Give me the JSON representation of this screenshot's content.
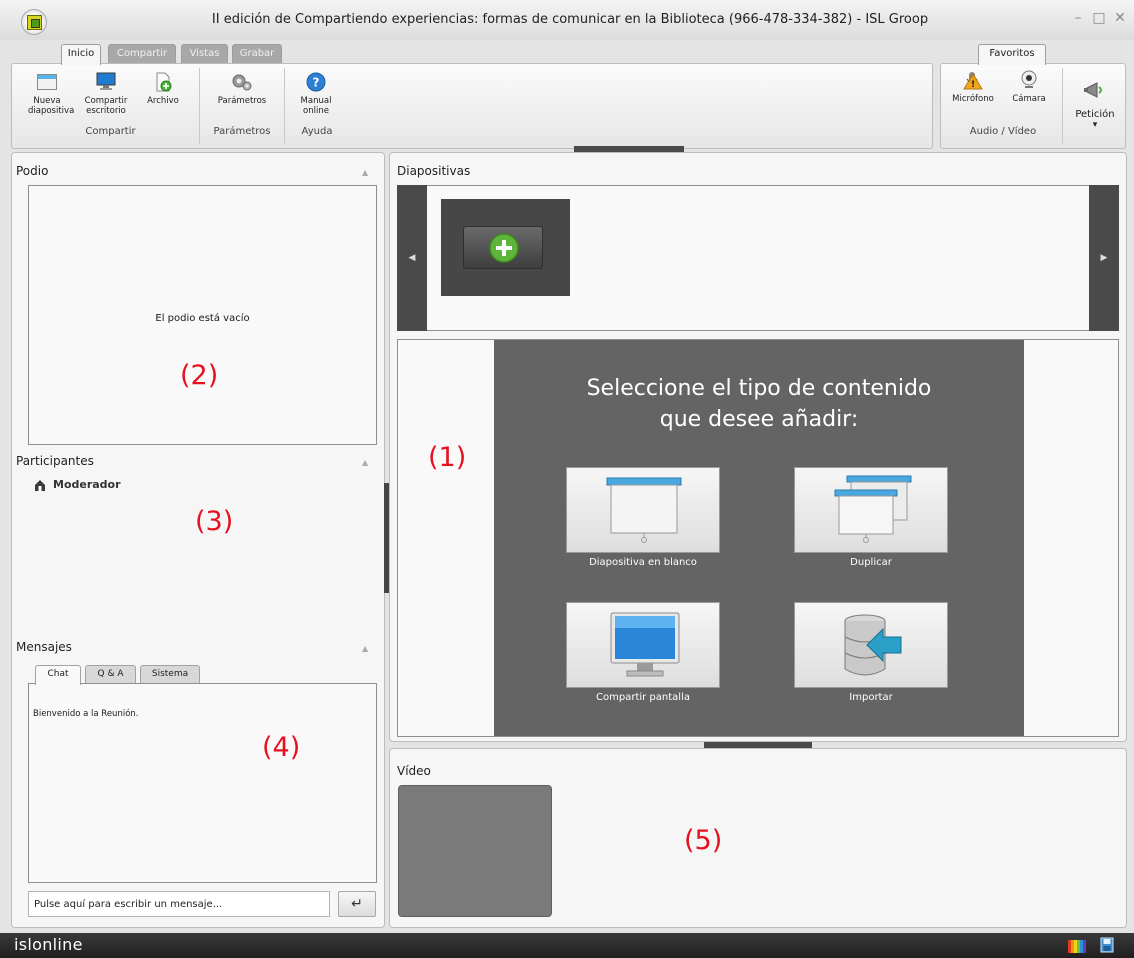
{
  "window": {
    "title": "II edición de Compartiendo experiencias: formas de comunicar en la Biblioteca (966-478-334-382) - ISL Groop",
    "controls": {
      "minimize": "–",
      "maximize": "□",
      "close": "✕"
    }
  },
  "ribbon": {
    "tabs": [
      "Inicio",
      "Compartir",
      "Vistas",
      "Grabar"
    ],
    "active_tab": "Inicio",
    "favorites_tab": "Favoritos",
    "groups": {
      "compartir": {
        "label": "Compartir",
        "buttons": [
          {
            "line1": "Nueva",
            "line2": "diapositiva",
            "icon": "slide-icon"
          },
          {
            "line1": "Compartir",
            "line2": "escritorio",
            "icon": "monitor-icon"
          },
          {
            "line1": "Archivo",
            "line2": "",
            "icon": "file-add-icon"
          }
        ]
      },
      "parametros": {
        "label": "Parámetros",
        "buttons": [
          {
            "line1": "Parámetros",
            "line2": "",
            "icon": "gears-icon"
          }
        ]
      },
      "ayuda": {
        "label": "Ayuda",
        "buttons": [
          {
            "line1": "Manual",
            "line2": "online",
            "icon": "help-icon"
          }
        ]
      },
      "audio_video": {
        "label": "Audio / Vídeo",
        "buttons": [
          {
            "line1": "Micrófono",
            "icon": "microphone-warning-icon"
          },
          {
            "line1": "Cámara",
            "icon": "webcam-icon"
          }
        ]
      },
      "peticion": {
        "label": "Petición",
        "icon": "megaphone-icon",
        "arrow": "▾"
      }
    }
  },
  "left": {
    "podio": {
      "title": "Podio",
      "empty_text": "El podio está vacío",
      "marker": "(2)",
      "collapse": "▲"
    },
    "participantes": {
      "title": "Participantes",
      "moderator": "Moderador",
      "marker": "(3)",
      "collapse": "▲"
    },
    "mensajes": {
      "title": "Mensajes",
      "collapse": "▲",
      "tabs": [
        "Chat",
        "Q & A",
        "Sistema"
      ],
      "active_tab": "Chat",
      "messages": [
        "Bienvenido a la Reunión."
      ],
      "marker": "(4)",
      "input_placeholder": "Pulse aquí para escribir un mensaje...",
      "send_icon": "↵"
    }
  },
  "right": {
    "diapositivas": {
      "title": "Diapositivas",
      "prev": "◀",
      "next": "▶"
    },
    "content": {
      "marker": "(1)",
      "heading_line1": "Seleccione el tipo de contenido",
      "heading_line2": "que desee añadir:",
      "options": [
        {
          "label": "Diapositiva en blanco",
          "icon": "blank-slide-icon"
        },
        {
          "label": "Duplicar",
          "icon": "duplicate-slides-icon"
        },
        {
          "label": "Compartir pantalla",
          "icon": "screen-share-icon"
        },
        {
          "label": "Importar",
          "icon": "import-database-icon"
        }
      ]
    },
    "video": {
      "title": "Vídeo",
      "marker": "(5)"
    }
  },
  "statusbar": {
    "brand": "islonline"
  },
  "colors": {
    "accent_marker": "#e8101e",
    "dark_content": "#646464",
    "panel_bg": "#f6f6f6",
    "statusbar": "#262626"
  }
}
